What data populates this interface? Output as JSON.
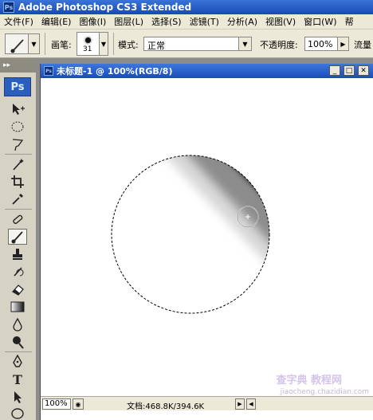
{
  "app": {
    "title": "Adobe Photoshop CS3 Extended",
    "icon": "ps-app-icon"
  },
  "menu": [
    "文件(F)",
    "编辑(E)",
    "图像(I)",
    "图层(L)",
    "选择(S)",
    "滤镜(T)",
    "分析(A)",
    "视图(V)",
    "窗口(W)",
    "帮"
  ],
  "options": {
    "brush_label": "画笔:",
    "brush_size": "31",
    "mode_label": "模式:",
    "mode_value": "正常",
    "opacity_label": "不透明度:",
    "opacity_value": "100%",
    "flow_label": "流量"
  },
  "toolbox": {
    "logo": "Ps",
    "tools": [
      "move-tool",
      "marquee-tool",
      "lasso-tool",
      "magic-wand-tool",
      "crop-tool",
      "eyedropper-tool",
      "healing-tool",
      "brush-tool",
      "clone-stamp-tool",
      "history-brush-tool",
      "eraser-tool",
      "gradient-tool",
      "blur-tool",
      "dodge-tool",
      "pen-tool",
      "type-tool",
      "path-selection-tool",
      "shape-tool"
    ],
    "active_tool": "brush-tool"
  },
  "document": {
    "title": "未标题-1 @ 100%(RGB/8)",
    "zoom": "100%",
    "info": "文档:468.8K/394.6K"
  },
  "watermark": {
    "line1": "查字典 教程网",
    "line2": "jiaocheng.chazidian.com"
  }
}
